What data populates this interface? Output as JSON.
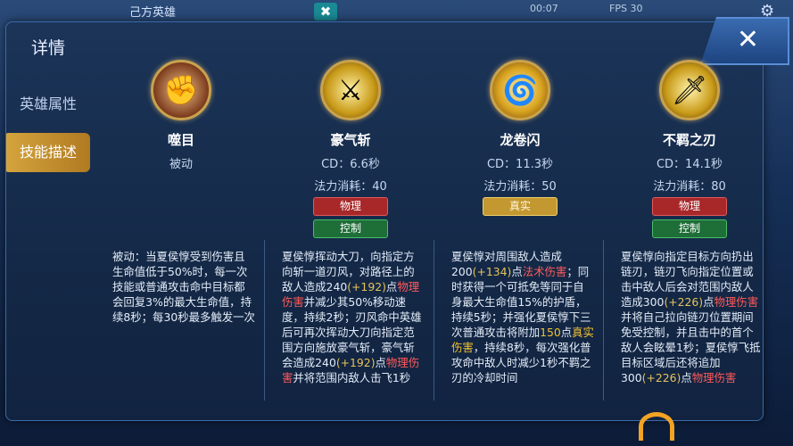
{
  "topbar": {
    "title": "己方英雄",
    "close_glyph": "✖",
    "timer": "00:07",
    "fps": "FPS 30",
    "icon": "gear-icon"
  },
  "sidebar": {
    "title": "详情",
    "items": [
      {
        "label": "英雄属性",
        "active": false
      },
      {
        "label": "技能描述",
        "active": true
      }
    ]
  },
  "close_label": "✕",
  "skills": [
    {
      "name": "噬目",
      "icon": "fist-icon",
      "type": "被动",
      "cd": "",
      "cost": "",
      "tags": [],
      "desc": "被动：当夏侯惇受到伤害且生命值低于50%时，每一次技能或普通攻击命中目标都会回复3%的最大生命值，持续8秒；每30秒最多触发一次"
    },
    {
      "name": "豪气斩",
      "icon": "blade-icon",
      "type": "",
      "cd": "CD：6.6秒",
      "cost": "法力消耗：40",
      "tags": [
        {
          "label": "物理",
          "kind": "phys"
        },
        {
          "label": "控制",
          "kind": "ctrl"
        }
      ],
      "desc_parts": [
        {
          "t": "夏侯惇挥动大刀，向指定方向斩一道刃风，对路径上的敌人造成240",
          "c": ""
        },
        {
          "t": "(+192)",
          "c": "n"
        },
        {
          "t": "点",
          "c": ""
        },
        {
          "t": "物理伤害",
          "c": "r"
        },
        {
          "t": "并减少其50%移动速度，持续2秒；刃风命中英雄后可再次挥动大刀向指定范围方向施放豪气斩，豪气斩会造成240",
          "c": ""
        },
        {
          "t": "(+192)",
          "c": "n"
        },
        {
          "t": "点",
          "c": ""
        },
        {
          "t": "物理伤害",
          "c": "r"
        },
        {
          "t": "并将范围内敌人击飞1秒",
          "c": ""
        }
      ]
    },
    {
      "name": "龙卷闪",
      "icon": "whirlwind-icon",
      "type": "",
      "cd": "CD：11.3秒",
      "cost": "法力消耗：50",
      "tags": [
        {
          "label": "真实",
          "kind": "true"
        }
      ],
      "desc_parts": [
        {
          "t": "夏侯惇对周围敌人造成200",
          "c": ""
        },
        {
          "t": "(+134)",
          "c": "n"
        },
        {
          "t": "点",
          "c": ""
        },
        {
          "t": "法术伤害",
          "c": "r"
        },
        {
          "t": "；同时获得一个可抵免等同于自身最大生命值15%的护盾，持续5秒；并强化夏侯惇下三次普通攻击将附加",
          "c": ""
        },
        {
          "t": "150",
          "c": "y"
        },
        {
          "t": "点",
          "c": ""
        },
        {
          "t": "真实伤害",
          "c": "y"
        },
        {
          "t": "，持续8秒，每次强化普攻命中敌人时减少1秒不羁之刃的冷却时间",
          "c": ""
        }
      ]
    },
    {
      "name": "不羁之刃",
      "icon": "chain-blade-icon",
      "type": "",
      "cd": "CD：14.1秒",
      "cost": "法力消耗：80",
      "tags": [
        {
          "label": "物理",
          "kind": "phys"
        },
        {
          "label": "控制",
          "kind": "ctrl"
        }
      ],
      "desc_parts": [
        {
          "t": "夏侯惇向指定目标方向扔出链刃，链刃飞向指定位置或击中敌人后会对范围内敌人造成300",
          "c": ""
        },
        {
          "t": "(+226)",
          "c": "n"
        },
        {
          "t": "点",
          "c": ""
        },
        {
          "t": "物理伤害",
          "c": "r"
        },
        {
          "t": "并将自己拉向链刃位置期间免受控制，并且击中的首个敌人会眩晕1秒；夏侯惇飞抵目标区域后还将追加300",
          "c": ""
        },
        {
          "t": "(+226)",
          "c": "n"
        },
        {
          "t": "点",
          "c": ""
        },
        {
          "t": "物理伤害",
          "c": "r"
        }
      ]
    }
  ],
  "colors": {
    "accent": "#d4a43c",
    "phys": "#a8282a",
    "ctrl": "#1e6e38",
    "true": "#c49830",
    "highlight_num": "#e6c35a",
    "highlight_dmg": "#ff5a5a"
  }
}
